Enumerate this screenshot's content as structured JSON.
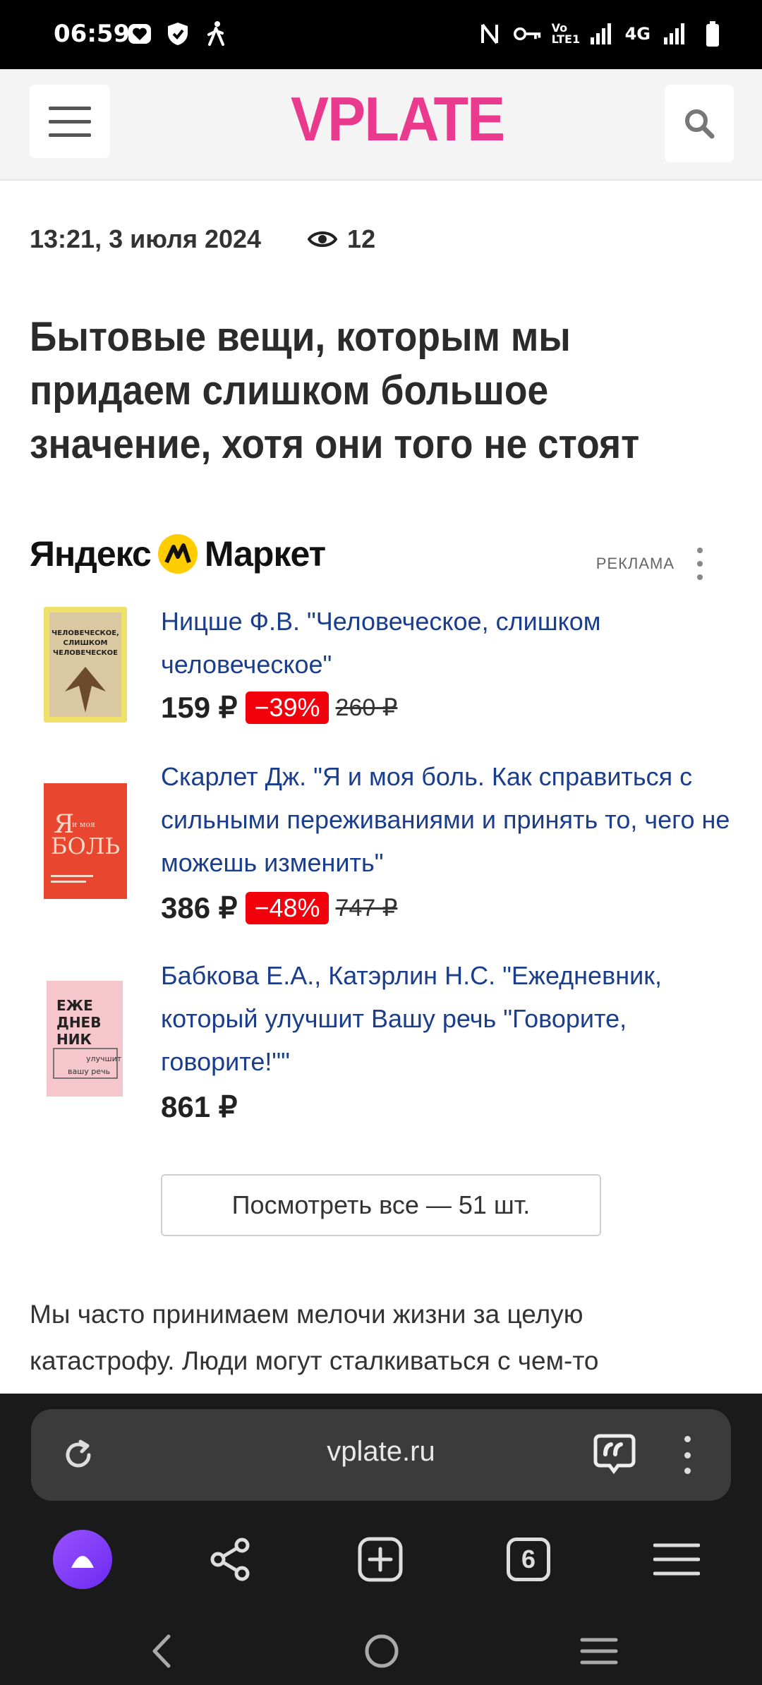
{
  "status_bar": {
    "time": "06:59",
    "network": "4G",
    "volte": "Vo LTE1",
    "icons": [
      "heart-box-icon",
      "shield-icon",
      "walking-icon",
      "nfc-icon",
      "key-icon",
      "volte-icon",
      "signal-icon",
      "signal-4g-icon",
      "battery-icon"
    ]
  },
  "header": {
    "logo": "VPLATE",
    "logo_color": "#ea3a8e"
  },
  "article": {
    "datetime": "13:21, 3 июля 2024",
    "views": "12",
    "title": "Бытовые вещи, которым мы придаем слишком большое значение, хотя они того не стоят",
    "body": "Мы часто принимаем мелочи жизни за целую катастрофу. Люди могут сталкиваться с чем-то"
  },
  "market": {
    "brand_left": "Яндекс",
    "brand_right": "Маркет",
    "ad_label": "РЕКЛАМА",
    "products": [
      {
        "title": "Ницше Ф.В. \"Человеческое, слишком человеческое\"",
        "price": "159 ₽",
        "discount": "−39%",
        "old_price": "260 ₽",
        "cover_text": "ЧЕЛОВЕЧЕСКОЕ, СЛИШКОМ ЧЕЛОВЕЧЕСКОЕ"
      },
      {
        "title": "Скарлет Дж. \"Я и моя боль. Как справиться с сильными переживаниями и принять то, чего не можешь изменить\"",
        "price": "386 ₽",
        "discount": "−48%",
        "old_price": "747 ₽",
        "cover_text": "Я И МОЯ БОЛЬ"
      },
      {
        "title": "Бабкова Е.А., Катэрлин Н.С. \"Ежедневник, который улучшит Вашу речь \"Говорите, говорите!\"\"",
        "price": "861 ₽",
        "cover_text": "ЕЖЕ ДНЕВ НИК улучшит вашу речь"
      }
    ],
    "view_all": "Посмотреть все — 51 шт."
  },
  "browser": {
    "url": "vplate.ru",
    "tabs_count": "6"
  }
}
